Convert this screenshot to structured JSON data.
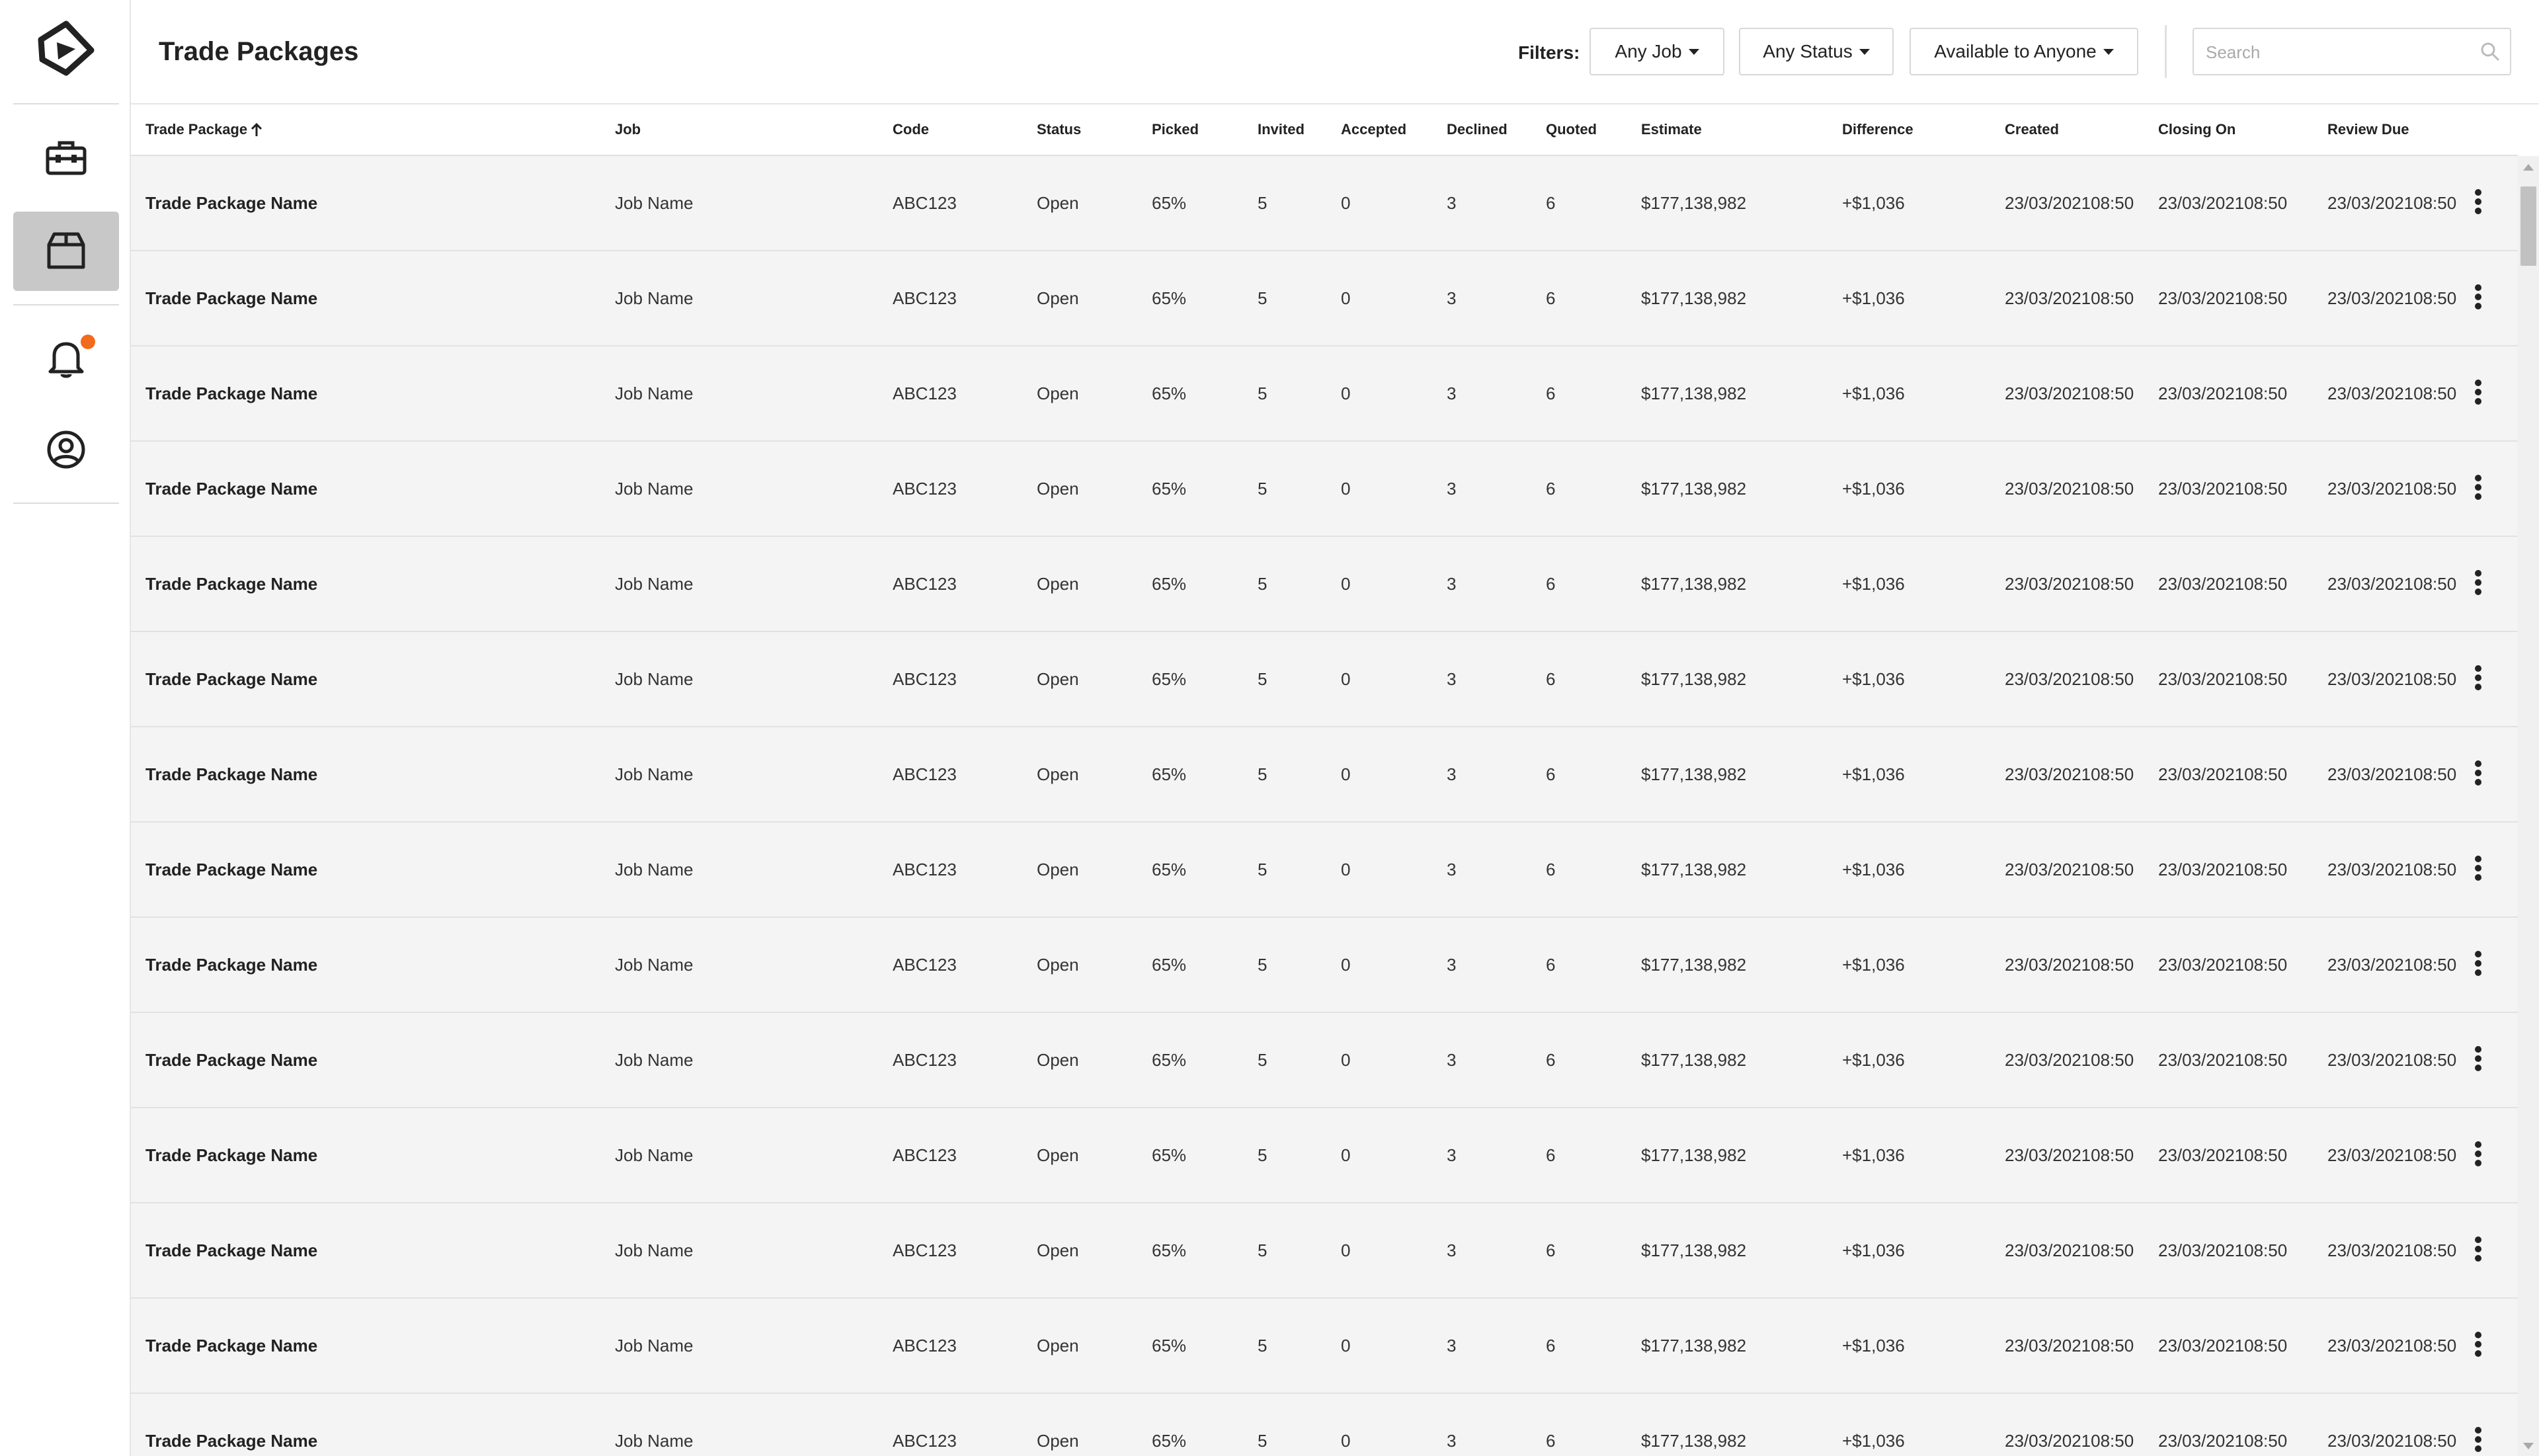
{
  "app": {
    "logo_icon": "app-logo-icon",
    "nav": [
      {
        "id": "jobs",
        "icon": "toolbox-icon",
        "active": false
      },
      {
        "id": "trade-packages",
        "icon": "box-icon",
        "active": true
      },
      {
        "id": "notifications",
        "icon": "bell-icon",
        "active": false,
        "badge": true
      },
      {
        "id": "account",
        "icon": "user-circle-icon",
        "active": false
      }
    ],
    "accent_color": "#f26a1b",
    "active_nav_bg": "#c8c8c8"
  },
  "header": {
    "title": "Trade Packages",
    "filters_label": "Filters:",
    "filter_job": "Any Job",
    "filter_status": "Any Status",
    "filter_availability": "Available to Anyone",
    "search_placeholder": "Search"
  },
  "table": {
    "columns": [
      "Trade Package",
      "Job",
      "Code",
      "Status",
      "Picked",
      "Invited",
      "Accepted",
      "Declined",
      "Quoted",
      "Estimate",
      "Difference",
      "Created",
      "Closing On",
      "Review Due"
    ],
    "sort_column": "Trade Package",
    "rows": [
      {
        "name": "Trade Package Name",
        "job": "Job Name",
        "code": "ABC123",
        "status": "Open",
        "picked": "65%",
        "invited": "5",
        "accepted": "0",
        "declined": "3",
        "quoted": "6",
        "estimate": "$177,138,982",
        "difference": "+$1,036",
        "created_date": "23/03/2021",
        "created_time": "08:50",
        "closing_date": "23/03/2021",
        "closing_time": "08:50",
        "review_date": "23/03/2021",
        "review_time": "08:50"
      },
      {
        "name": "Trade Package Name",
        "job": "Job Name",
        "code": "ABC123",
        "status": "Open",
        "picked": "65%",
        "invited": "5",
        "accepted": "0",
        "declined": "3",
        "quoted": "6",
        "estimate": "$177,138,982",
        "difference": "+$1,036",
        "created_date": "23/03/2021",
        "created_time": "08:50",
        "closing_date": "23/03/2021",
        "closing_time": "08:50",
        "review_date": "23/03/2021",
        "review_time": "08:50"
      },
      {
        "name": "Trade Package Name",
        "job": "Job Name",
        "code": "ABC123",
        "status": "Open",
        "picked": "65%",
        "invited": "5",
        "accepted": "0",
        "declined": "3",
        "quoted": "6",
        "estimate": "$177,138,982",
        "difference": "+$1,036",
        "created_date": "23/03/2021",
        "created_time": "08:50",
        "closing_date": "23/03/2021",
        "closing_time": "08:50",
        "review_date": "23/03/2021",
        "review_time": "08:50"
      },
      {
        "name": "Trade Package Name",
        "job": "Job Name",
        "code": "ABC123",
        "status": "Open",
        "picked": "65%",
        "invited": "5",
        "accepted": "0",
        "declined": "3",
        "quoted": "6",
        "estimate": "$177,138,982",
        "difference": "+$1,036",
        "created_date": "23/03/2021",
        "created_time": "08:50",
        "closing_date": "23/03/2021",
        "closing_time": "08:50",
        "review_date": "23/03/2021",
        "review_time": "08:50"
      },
      {
        "name": "Trade Package Name",
        "job": "Job Name",
        "code": "ABC123",
        "status": "Open",
        "picked": "65%",
        "invited": "5",
        "accepted": "0",
        "declined": "3",
        "quoted": "6",
        "estimate": "$177,138,982",
        "difference": "+$1,036",
        "created_date": "23/03/2021",
        "created_time": "08:50",
        "closing_date": "23/03/2021",
        "closing_time": "08:50",
        "review_date": "23/03/2021",
        "review_time": "08:50"
      },
      {
        "name": "Trade Package Name",
        "job": "Job Name",
        "code": "ABC123",
        "status": "Open",
        "picked": "65%",
        "invited": "5",
        "accepted": "0",
        "declined": "3",
        "quoted": "6",
        "estimate": "$177,138,982",
        "difference": "+$1,036",
        "created_date": "23/03/2021",
        "created_time": "08:50",
        "closing_date": "23/03/2021",
        "closing_time": "08:50",
        "review_date": "23/03/2021",
        "review_time": "08:50"
      },
      {
        "name": "Trade Package Name",
        "job": "Job Name",
        "code": "ABC123",
        "status": "Open",
        "picked": "65%",
        "invited": "5",
        "accepted": "0",
        "declined": "3",
        "quoted": "6",
        "estimate": "$177,138,982",
        "difference": "+$1,036",
        "created_date": "23/03/2021",
        "created_time": "08:50",
        "closing_date": "23/03/2021",
        "closing_time": "08:50",
        "review_date": "23/03/2021",
        "review_time": "08:50"
      },
      {
        "name": "Trade Package Name",
        "job": "Job Name",
        "code": "ABC123",
        "status": "Open",
        "picked": "65%",
        "invited": "5",
        "accepted": "0",
        "declined": "3",
        "quoted": "6",
        "estimate": "$177,138,982",
        "difference": "+$1,036",
        "created_date": "23/03/2021",
        "created_time": "08:50",
        "closing_date": "23/03/2021",
        "closing_time": "08:50",
        "review_date": "23/03/2021",
        "review_time": "08:50"
      },
      {
        "name": "Trade Package Name",
        "job": "Job Name",
        "code": "ABC123",
        "status": "Open",
        "picked": "65%",
        "invited": "5",
        "accepted": "0",
        "declined": "3",
        "quoted": "6",
        "estimate": "$177,138,982",
        "difference": "+$1,036",
        "created_date": "23/03/2021",
        "created_time": "08:50",
        "closing_date": "23/03/2021",
        "closing_time": "08:50",
        "review_date": "23/03/2021",
        "review_time": "08:50"
      },
      {
        "name": "Trade Package Name",
        "job": "Job Name",
        "code": "ABC123",
        "status": "Open",
        "picked": "65%",
        "invited": "5",
        "accepted": "0",
        "declined": "3",
        "quoted": "6",
        "estimate": "$177,138,982",
        "difference": "+$1,036",
        "created_date": "23/03/2021",
        "created_time": "08:50",
        "closing_date": "23/03/2021",
        "closing_time": "08:50",
        "review_date": "23/03/2021",
        "review_time": "08:50"
      },
      {
        "name": "Trade Package Name",
        "job": "Job Name",
        "code": "ABC123",
        "status": "Open",
        "picked": "65%",
        "invited": "5",
        "accepted": "0",
        "declined": "3",
        "quoted": "6",
        "estimate": "$177,138,982",
        "difference": "+$1,036",
        "created_date": "23/03/2021",
        "created_time": "08:50",
        "closing_date": "23/03/2021",
        "closing_time": "08:50",
        "review_date": "23/03/2021",
        "review_time": "08:50"
      },
      {
        "name": "Trade Package Name",
        "job": "Job Name",
        "code": "ABC123",
        "status": "Open",
        "picked": "65%",
        "invited": "5",
        "accepted": "0",
        "declined": "3",
        "quoted": "6",
        "estimate": "$177,138,982",
        "difference": "+$1,036",
        "created_date": "23/03/2021",
        "created_time": "08:50",
        "closing_date": "23/03/2021",
        "closing_time": "08:50",
        "review_date": "23/03/2021",
        "review_time": "08:50"
      },
      {
        "name": "Trade Package Name",
        "job": "Job Name",
        "code": "ABC123",
        "status": "Open",
        "picked": "65%",
        "invited": "5",
        "accepted": "0",
        "declined": "3",
        "quoted": "6",
        "estimate": "$177,138,982",
        "difference": "+$1,036",
        "created_date": "23/03/2021",
        "created_time": "08:50",
        "closing_date": "23/03/2021",
        "closing_time": "08:50",
        "review_date": "23/03/2021",
        "review_time": "08:50"
      },
      {
        "name": "Trade Package Name",
        "job": "Job Name",
        "code": "ABC123",
        "status": "Open",
        "picked": "65%",
        "invited": "5",
        "accepted": "0",
        "declined": "3",
        "quoted": "6",
        "estimate": "$177,138,982",
        "difference": "+$1,036",
        "created_date": "23/03/2021",
        "created_time": "08:50",
        "closing_date": "23/03/2021",
        "closing_time": "08:50",
        "review_date": "23/03/2021",
        "review_time": "08:50"
      }
    ]
  }
}
